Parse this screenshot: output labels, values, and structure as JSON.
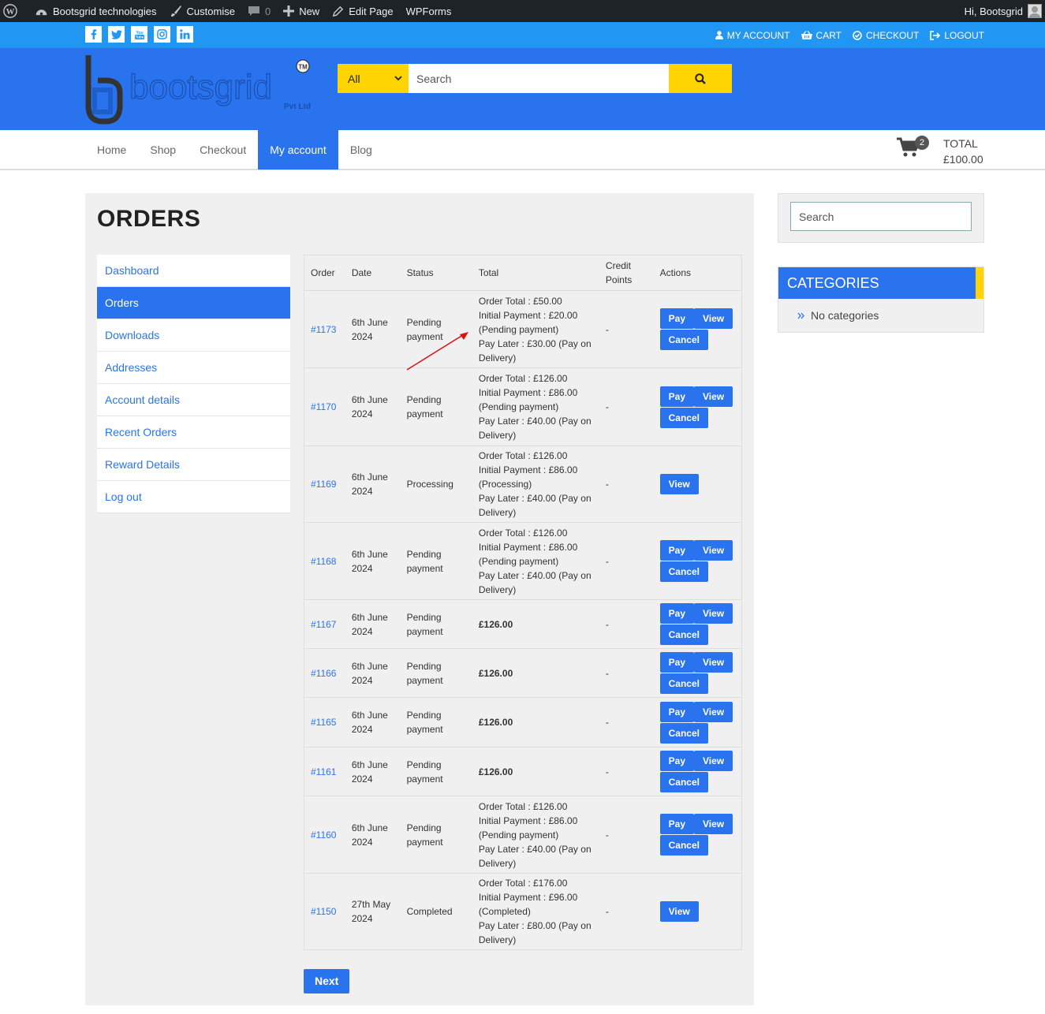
{
  "adminbar": {
    "site_name": "Bootsgrid technologies",
    "customise": "Customise",
    "comments_count": "0",
    "new": "New",
    "edit_page": "Edit Page",
    "wpforms": "WPForms",
    "greeting": "Hi, Bootsgrid"
  },
  "topbar": {
    "social": [
      "f",
      "t",
      "yt",
      "ig",
      "in"
    ],
    "links": {
      "my_account": "MY ACCOUNT",
      "cart": "CART",
      "checkout": "CHECKOUT",
      "logout": "LOGOUT"
    }
  },
  "header": {
    "logo_text": "bootsgrid",
    "logo_sub": "Pvt Ltd",
    "logo_tm": "TM",
    "search": {
      "category": "All",
      "placeholder": "Search"
    }
  },
  "nav": {
    "items": [
      "Home",
      "Shop",
      "Checkout",
      "My account",
      "Blog"
    ],
    "active": "My account",
    "cart": {
      "count": "2",
      "total_label": "TOTAL",
      "total_value": "£100.00"
    }
  },
  "page": {
    "title": "ORDERS"
  },
  "account_nav": {
    "items": [
      "Dashboard",
      "Orders",
      "Downloads",
      "Addresses",
      "Account details",
      "Recent Orders",
      "Reward Details",
      "Log out"
    ],
    "active": "Orders"
  },
  "orders_table": {
    "headers": {
      "order": "Order",
      "date": "Date",
      "status": "Status",
      "total": "Total",
      "credit": "Credit Points",
      "actions": "Actions"
    },
    "buttons": {
      "pay": "Pay",
      "view": "View",
      "cancel": "Cancel"
    },
    "rows": [
      {
        "order": "#1173",
        "date": "6th June 2024",
        "status": "Pending payment",
        "total_lines": [
          "Order Total : £50.00",
          "Initial Payment : £20.00 (Pending payment)",
          "Pay Later : £30.00 (Pay on Delivery)"
        ],
        "credit": "-",
        "actions": "pay_view_cancel"
      },
      {
        "order": "#1170",
        "date": "6th June 2024",
        "status": "Pending payment",
        "total_lines": [
          "Order Total : £126.00",
          "Initial Payment : £86.00 (Pending payment)",
          "Pay Later : £40.00 (Pay on Delivery)"
        ],
        "credit": "-",
        "actions": "pay_view_cancel"
      },
      {
        "order": "#1169",
        "date": "6th June 2024",
        "status": "Processing",
        "total_lines": [
          "Order Total : £126.00",
          "Initial Payment : £86.00 (Processing)",
          "Pay Later : £40.00 (Pay on Delivery)"
        ],
        "credit": "-",
        "actions": "view"
      },
      {
        "order": "#1168",
        "date": "6th June 2024",
        "status": "Pending payment",
        "total_lines": [
          "Order Total : £126.00",
          "Initial Payment : £86.00 (Pending payment)",
          "Pay Later : £40.00 (Pay on Delivery)"
        ],
        "credit": "-",
        "actions": "pay_view_cancel"
      },
      {
        "order": "#1167",
        "date": "6th June 2024",
        "status": "Pending payment",
        "total": "£126.00",
        "credit": "-",
        "actions": "pay_view_cancel"
      },
      {
        "order": "#1166",
        "date": "6th June 2024",
        "status": "Pending payment",
        "total": "£126.00",
        "credit": "-",
        "actions": "pay_view_cancel"
      },
      {
        "order": "#1165",
        "date": "6th June 2024",
        "status": "Pending payment",
        "total": "£126.00",
        "credit": "-",
        "actions": "pay_view_cancel"
      },
      {
        "order": "#1161",
        "date": "6th June 2024",
        "status": "Pending payment",
        "total": "£126.00",
        "credit": "-",
        "actions": "pay_view_cancel"
      },
      {
        "order": "#1160",
        "date": "6th June 2024",
        "status": "Pending payment",
        "total_lines": [
          "Order Total : £126.00",
          "Initial Payment : £86.00 (Pending payment)",
          "Pay Later : £40.00 (Pay on Delivery)"
        ],
        "credit": "-",
        "actions": "pay_view_cancel"
      },
      {
        "order": "#1150",
        "date": "27th May 2024",
        "status": "Completed",
        "total_lines": [
          "Order Total : £176.00",
          "Initial Payment : £96.00 (Completed)",
          "Pay Later : £80.00 (Pay on Delivery)"
        ],
        "credit": "-",
        "actions": "view"
      }
    ]
  },
  "pagination": {
    "next": "Next"
  },
  "sidebar": {
    "search_placeholder": "Search",
    "categories_title": "CATEGORIES",
    "categories_empty": "No categories"
  },
  "colors": {
    "primary": "#2a73ee",
    "topstrip": "#2196f3",
    "accent": "#ffd400",
    "adminbar": "#1d2327"
  }
}
